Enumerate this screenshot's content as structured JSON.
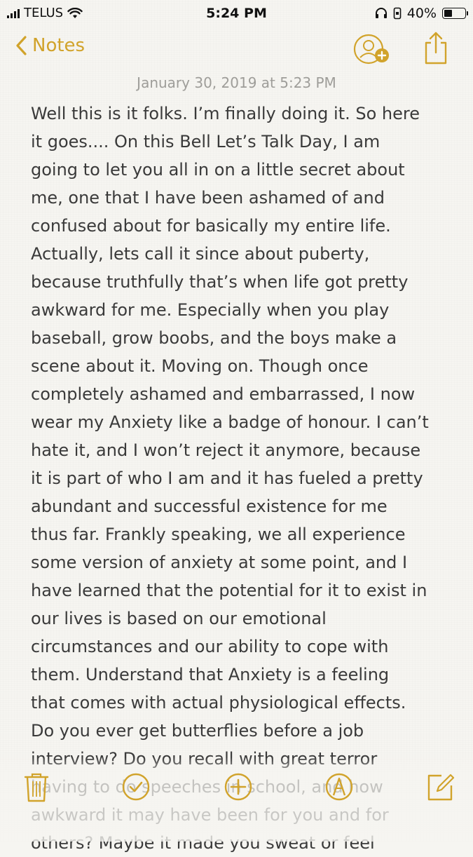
{
  "status_bar": {
    "carrier": "TELUS",
    "time": "5:24 PM",
    "battery_percent": "40%",
    "battery_level": 0.4,
    "icons": [
      "signal-icon",
      "wifi-icon",
      "headphones-icon",
      "battery-icon"
    ]
  },
  "nav": {
    "back_label": "Notes",
    "accent_color": "#d1a32b",
    "icons": [
      "chevron-left-icon",
      "add-people-icon",
      "share-icon"
    ]
  },
  "note": {
    "date": "January 30, 2019 at 5:23 PM",
    "lines": [
      "Well this is it folks.  I’m finally doing it.  So here",
      "it goes....  On this Bell Let’s Talk Day,  I am",
      "going to let you all in on a little secret about",
      "me, one that I have been ashamed of and",
      "confused about for basically my entire life.",
      "Actually, lets call it since about puberty,",
      "because truthfully that’s when life got pretty",
      "awkward for me. Especially when you play",
      "baseball, grow boobs, and the boys make a",
      "scene about it.  Moving on. Though once",
      "completely ashamed and embarrassed, I now",
      "wear my Anxiety like a badge of honour. I can’t",
      "hate it, and I won’t reject it anymore, because",
      "it is part of who I am and it has fueled a pretty",
      "abundant and successful existence for me",
      "thus far. Frankly speaking, we all experience",
      "some version of anxiety at some point,  and I",
      "have learned that the potential for it to exist in",
      "our lives is based on our emotional",
      "circumstances and our ability to cope with",
      "them.  Understand that Anxiety is a feeling",
      "that comes with actual physiological effects.",
      "Do you ever get butterflies before a job",
      "interview?  Do you recall with great terror",
      "having to do speeches in school, and how",
      "awkward it may have been for you and for",
      "others? Maybe it made you sweat or feel"
    ]
  },
  "toolbar": {
    "icons": [
      "trash-icon",
      "checklist-icon",
      "add-icon",
      "markup-icon",
      "compose-icon"
    ]
  }
}
